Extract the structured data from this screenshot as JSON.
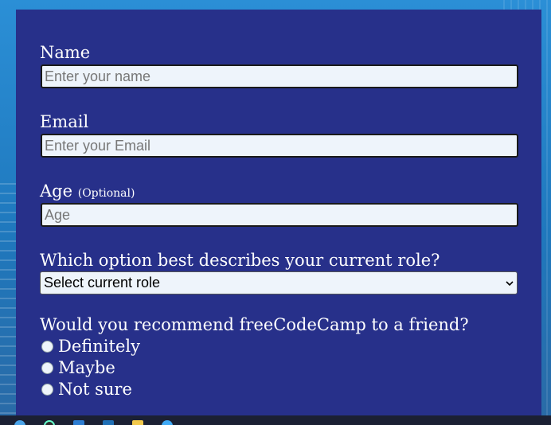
{
  "form": {
    "name": {
      "label": "Name",
      "placeholder": "Enter your name"
    },
    "email": {
      "label": "Email",
      "placeholder": "Enter your Email"
    },
    "age": {
      "label": "Age",
      "optional_note": "(Optional)",
      "placeholder": "Age"
    },
    "role": {
      "question": "Which option best describes your current role?",
      "selected": "Select current role"
    },
    "recommend": {
      "question": "Would you recommend freeCodeCamp to a friend?",
      "options": [
        "Definitely",
        "Maybe",
        "Not sure"
      ]
    }
  },
  "colors": {
    "panel": "#27308a",
    "background": "#1f7cc4",
    "input_bg": "#eef4fb",
    "text": "#ffffff"
  },
  "taskbar_icons": [
    "windows-icon",
    "chrome-icon",
    "terminal-icon",
    "editor-icon",
    "folder-icon",
    "browser-icon"
  ]
}
